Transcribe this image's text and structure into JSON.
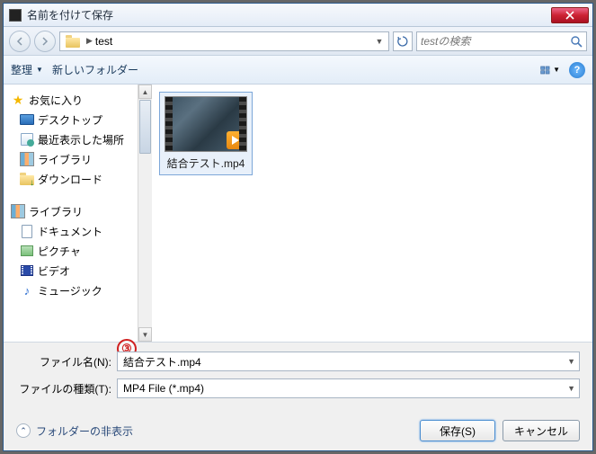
{
  "window": {
    "title": "名前を付けて保存"
  },
  "nav": {
    "path_segment": "test",
    "refresh": "↻"
  },
  "search": {
    "placeholder": "testの検索"
  },
  "toolbar": {
    "organize": "整理",
    "new_folder": "新しいフォルダー"
  },
  "sidebar": {
    "favorites_header": "お気に入り",
    "favorites": {
      "desktop": "デスクトップ",
      "recent": "最近表示した場所",
      "library": "ライブラリ",
      "downloads": "ダウンロード"
    },
    "library_header": "ライブラリ",
    "library": {
      "documents": "ドキュメント",
      "pictures": "ピクチャ",
      "videos": "ビデオ",
      "music": "ミュージック"
    }
  },
  "files": {
    "item1_name": "結合テスト.mp4"
  },
  "form": {
    "filename_label": "ファイル名(N):",
    "filename_value": "結合テスト.mp4",
    "filetype_label": "ファイルの種類(T):",
    "filetype_value": "MP4 File (*.mp4)"
  },
  "footer": {
    "hide_folders": "フォルダーの非表示",
    "save": "保存(S)",
    "cancel": "キャンセル"
  },
  "annotation": {
    "number": "③"
  }
}
